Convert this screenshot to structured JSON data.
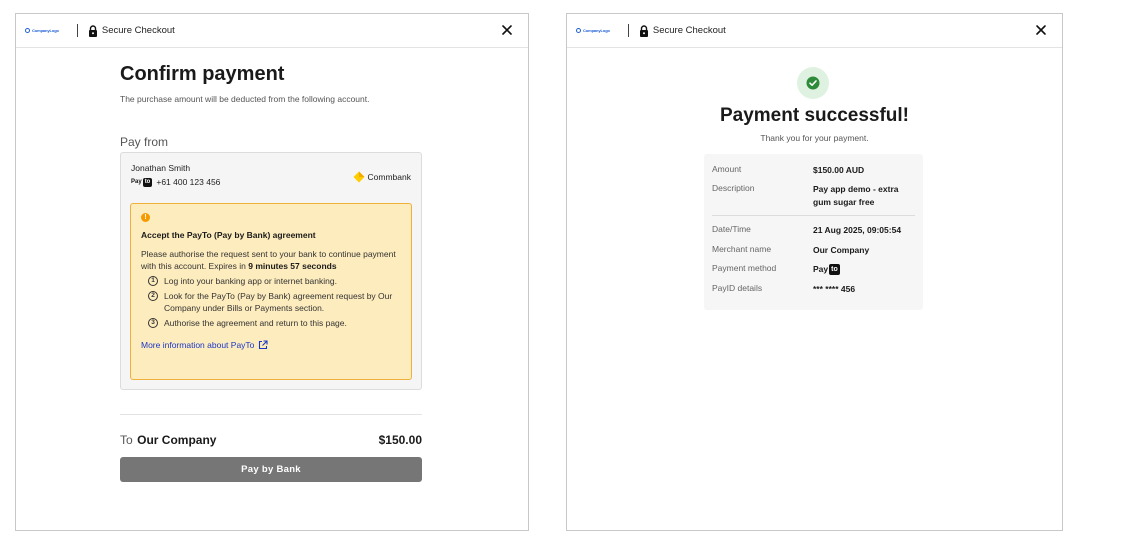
{
  "header": {
    "logo_text": "CompanyLogo",
    "title": "Secure Checkout",
    "close_symbol": "✕"
  },
  "confirm": {
    "title": "Confirm payment",
    "subtitle": "The purchase amount will be deducted from the following account.",
    "pay_from_label": "Pay from",
    "account": {
      "name": "Jonathan Smith",
      "payto_logo_text": "Pay",
      "payto_logo_mark": "to",
      "phone": "+61 400 123 456",
      "bank_name": "Commbank"
    },
    "agreement": {
      "icon_char": "!",
      "title": "Accept the PayTo (Pay by Bank) agreement",
      "desc_before": "Please authorise the request sent to your bank to continue payment with this account. Expires in ",
      "expires": "9 minutes 57 seconds",
      "steps": [
        {
          "num": "1",
          "text": "Log into your banking app or internet banking."
        },
        {
          "num": "2",
          "text": "Look for the PayTo (Pay by Bank) agreement request by Our Company under Bills or Payments section."
        },
        {
          "num": "3",
          "text": "Authorise the agreement and return to this page."
        }
      ],
      "more_link": "More information about PayTo"
    },
    "to_label": "To",
    "merchant": "Our Company",
    "amount": "$150.00",
    "pay_button": "Pay by Bank"
  },
  "success": {
    "title": "Payment successful!",
    "subtitle": "Thank you for your payment.",
    "rows": [
      {
        "label": "Amount",
        "value": "$150.00 AUD"
      },
      {
        "label": "Description",
        "value": "Pay app demo - extra gum sugar free"
      },
      {
        "label": "Date/Time",
        "value": "21 Aug 2025, 09:05:54"
      },
      {
        "label": "Merchant name",
        "value": "Our Company"
      },
      {
        "label": "Payment method",
        "value": "Pay"
      },
      {
        "label": "PayID details",
        "value": "*** **** 456"
      }
    ],
    "method_mark": "to"
  },
  "colors": {
    "accent_warning": "#f59b00",
    "warning_bg": "#fdecbd",
    "link": "#1a37c8",
    "success": "#2e8b3a",
    "button_disabled": "#767676"
  },
  "icons": [
    "lock-icon",
    "close-icon",
    "warning-icon",
    "external-link-icon",
    "check-circle-icon",
    "commbank-icon"
  ]
}
